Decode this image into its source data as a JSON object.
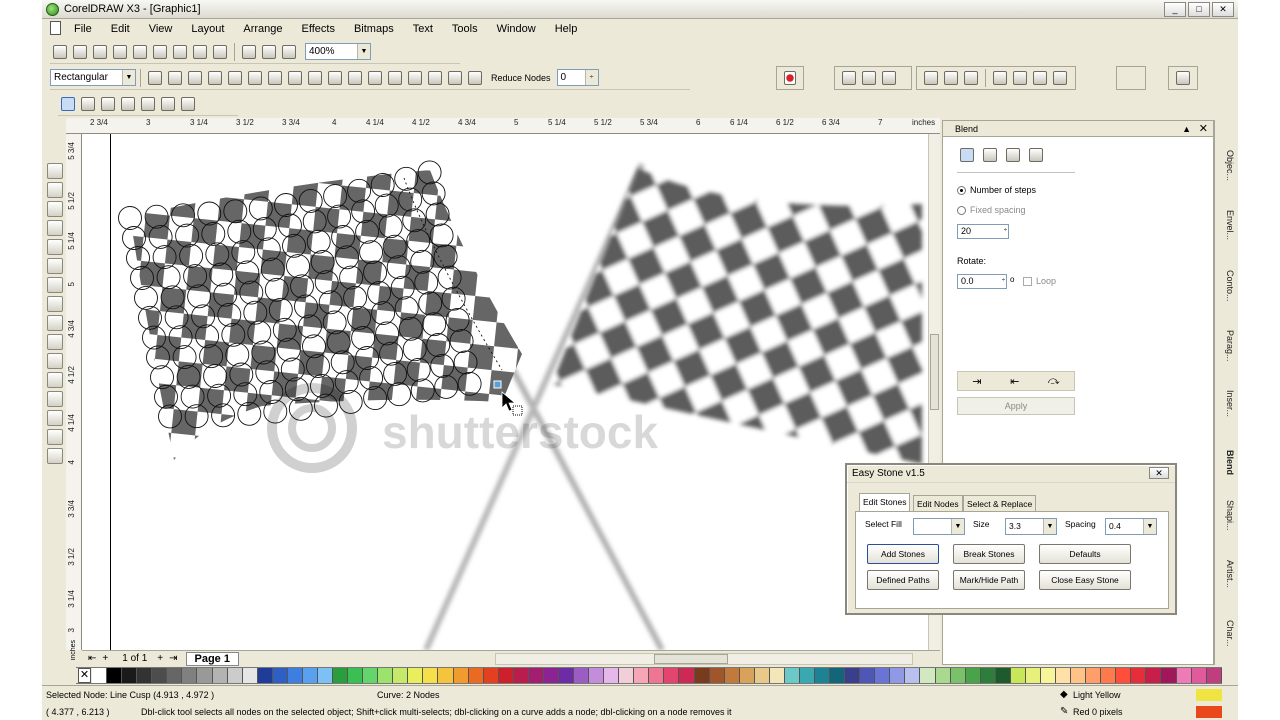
{
  "window": {
    "title": "CorelDRAW X3 - [Graphic1]",
    "minimize": "_",
    "restore": "□",
    "close": "✕"
  },
  "menu": [
    "File",
    "Edit",
    "View",
    "Layout",
    "Arrange",
    "Effects",
    "Bitmaps",
    "Text",
    "Tools",
    "Window",
    "Help"
  ],
  "standard_toolbar": {
    "zoom": "400%"
  },
  "property_bar": {
    "selection_mode": "Rectangular",
    "reduce_nodes_label": "Reduce Nodes",
    "reduce_nodes_value": "0"
  },
  "ruler": {
    "units": "inches",
    "ticks_h": [
      "2 3/4",
      "3",
      "3 1/4",
      "3 1/2",
      "3 3/4",
      "4",
      "4 1/4",
      "4 1/2",
      "4 3/4",
      "5",
      "5 1/4",
      "5 1/2",
      "5 3/4",
      "6",
      "6 1/4",
      "6 1/2",
      "6 3/4",
      "7"
    ],
    "ticks_v": [
      "5 3/4",
      "5 1/2",
      "5 1/4",
      "5",
      "4 3/4",
      "4 1/2",
      "4 1/4",
      "4",
      "3 3/4",
      "3 1/2",
      "3 1/4",
      "3"
    ]
  },
  "watermark": "shutterstock",
  "page_nav": {
    "count": "1 of 1",
    "page_tab": "Page 1",
    "units": "inches"
  },
  "docker": {
    "title": "Blend",
    "number_of_steps": "Number of steps",
    "fixed_spacing": "Fixed spacing",
    "steps_value": "20",
    "rotate_label": "Rotate:",
    "rotate_value": "0.0",
    "rotate_unit": "o",
    "loop_label": "Loop",
    "apply": "Apply"
  },
  "docker_tabs": [
    "Objec...",
    "Envel...",
    "Conto...",
    "Parag...",
    "Inser...",
    "Blend",
    "Shapi...",
    "Artist...",
    "Char..."
  ],
  "easy_stone": {
    "title": "Easy Stone v1.5",
    "tabs": [
      "Edit Stones",
      "Edit Nodes",
      "Select & Replace"
    ],
    "select_fill_label": "Select Fill",
    "size_label": "Size",
    "size_value": "3.3",
    "spacing_label": "Spacing",
    "spacing_value": "0.4",
    "buttons": [
      "Add Stones",
      "Break Stones",
      "Defaults",
      "Defined Paths",
      "Mark/Hide Path",
      "Close Easy Stone"
    ]
  },
  "status": {
    "selection": "Selected Node: Line Cusp (4.913 , 4.972 )",
    "curve": "Curve: 2 Nodes",
    "coords": "( 4.377 , 6.213 )",
    "hint": "Dbl-click tool selects all nodes on the selected object; Shift+click multi-selects; dbl-clicking on a curve adds a node; dbl-clicking on a node removes it",
    "fill_name": "Light Yellow",
    "fill_color": "#f0e442",
    "outline_name": "Red  0 pixels",
    "outline_color": "#e8481a"
  },
  "palette": [
    "#ffffff",
    "#000000",
    "#1a1a1a",
    "#333333",
    "#4d4d4d",
    "#666666",
    "#808080",
    "#999999",
    "#b3b3b3",
    "#cccccc",
    "#e6e6e6",
    "#1f3c99",
    "#2e5fc2",
    "#3d7ee0",
    "#5aa0f0",
    "#7cc0f5",
    "#2a9e3c",
    "#3cbf52",
    "#62d66b",
    "#9ce36e",
    "#c5ea6a",
    "#e8ee5c",
    "#f5e04a",
    "#f6c33c",
    "#f19b2e",
    "#ea6a24",
    "#e2401f",
    "#cf1f2a",
    "#b81d4d",
    "#a31d70",
    "#8b2393",
    "#6e2ba6",
    "#9b5cc4",
    "#c48ddc",
    "#e6b8ea",
    "#f2cfd8",
    "#f7a6b8",
    "#ef7592",
    "#e4456e",
    "#cc2a54",
    "#7a3b1c",
    "#a0562a",
    "#c27a3c",
    "#d9a25a",
    "#e9c98a",
    "#f3e6b8",
    "#6bc9c7",
    "#39a8b0",
    "#1d8294",
    "#136677",
    "#3a3f8c",
    "#4e56b6",
    "#6a74d6",
    "#8f99e6",
    "#b8c0f0",
    "#d0e9c0",
    "#a9d88f",
    "#79c26a",
    "#4aa34a",
    "#2d7d3b",
    "#1d5a2c",
    "#c8e65a",
    "#e6f07a",
    "#f7f49a",
    "#ffe1a8",
    "#ffc388",
    "#ff9e6a",
    "#ff7a4a",
    "#ff4f3a",
    "#e62e3a",
    "#c81e4a",
    "#a0185a",
    "#f07ab8",
    "#e05a9c",
    "#c03e80"
  ]
}
